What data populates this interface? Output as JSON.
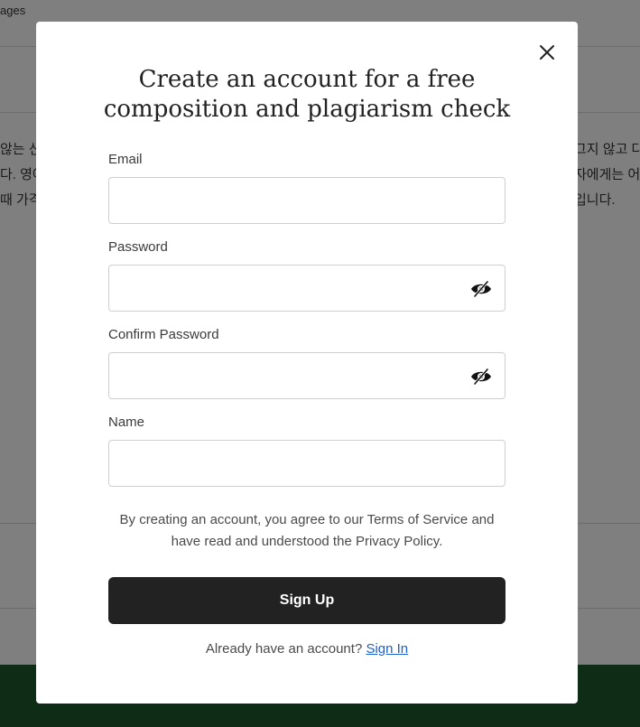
{
  "background": {
    "top_text": "ages",
    "lines": [
      "않는 신",
      "다. 영어",
      "때 가격",
      "그지 않고 다",
      "자에게는 어",
      "입니다."
    ],
    "footer_color": "#1f5a2c"
  },
  "modal": {
    "title_line1": "Create an account for a free",
    "title_line2": "composition and plagiarism check",
    "close_icon": "close-icon",
    "fields": {
      "email": {
        "label": "Email",
        "value": "",
        "placeholder": ""
      },
      "password": {
        "label": "Password",
        "value": "",
        "placeholder": "",
        "icon": "eye-slash-icon"
      },
      "confirm_password": {
        "label": "Confirm Password",
        "value": "",
        "placeholder": "",
        "icon": "eye-slash-icon"
      },
      "name": {
        "label": "Name",
        "value": "",
        "placeholder": ""
      }
    },
    "terms_line1": "By creating an account, you agree to our Terms of Service and",
    "terms_line2": "have read and understood the Privacy Policy.",
    "signup_label": "Sign Up",
    "signin_prompt": "Already have an account?",
    "signin_link": "Sign In"
  },
  "colors": {
    "button_bg": "#222222",
    "link": "#1a5fd1"
  }
}
